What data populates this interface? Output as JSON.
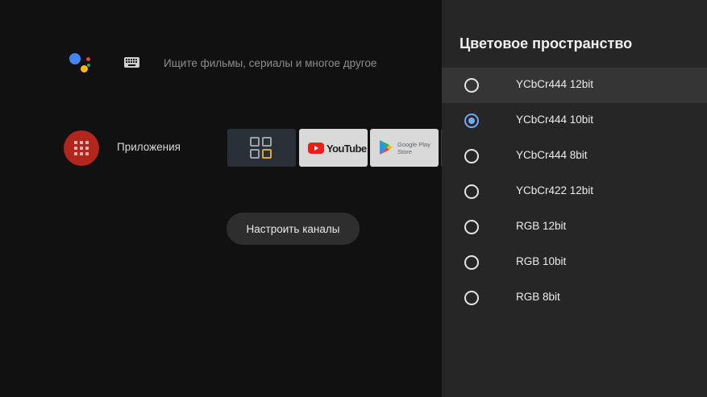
{
  "home": {
    "search_placeholder": "Ищите фильмы, сериалы и многое другое",
    "apps_label": "Приложения",
    "channels_button": "Настроить каналы",
    "tiles": {
      "youtube_text": "YouTube",
      "play_line1": "Google Play",
      "play_line2": "Store"
    }
  },
  "panel": {
    "title": "Цветовое пространство",
    "options": [
      {
        "label": "YCbCr444 12bit",
        "selected": false,
        "focused": true
      },
      {
        "label": "YCbCr444 10bit",
        "selected": true,
        "focused": false
      },
      {
        "label": "YCbCr444 8bit",
        "selected": false,
        "focused": false
      },
      {
        "label": "YCbCr422 12bit",
        "selected": false,
        "focused": false
      },
      {
        "label": "RGB 12bit",
        "selected": false,
        "focused": false
      },
      {
        "label": "RGB 10bit",
        "selected": false,
        "focused": false
      },
      {
        "label": "RGB 8bit",
        "selected": false,
        "focused": false
      }
    ]
  },
  "colors": {
    "accent": "#6fa8f5",
    "apps_circle": "#b3261e",
    "panel_bg": "#262626",
    "page_bg": "#111111"
  },
  "icons": [
    "google-assistant-icon",
    "keyboard-icon",
    "apps-grid-icon",
    "youtube-icon",
    "google-play-icon"
  ]
}
